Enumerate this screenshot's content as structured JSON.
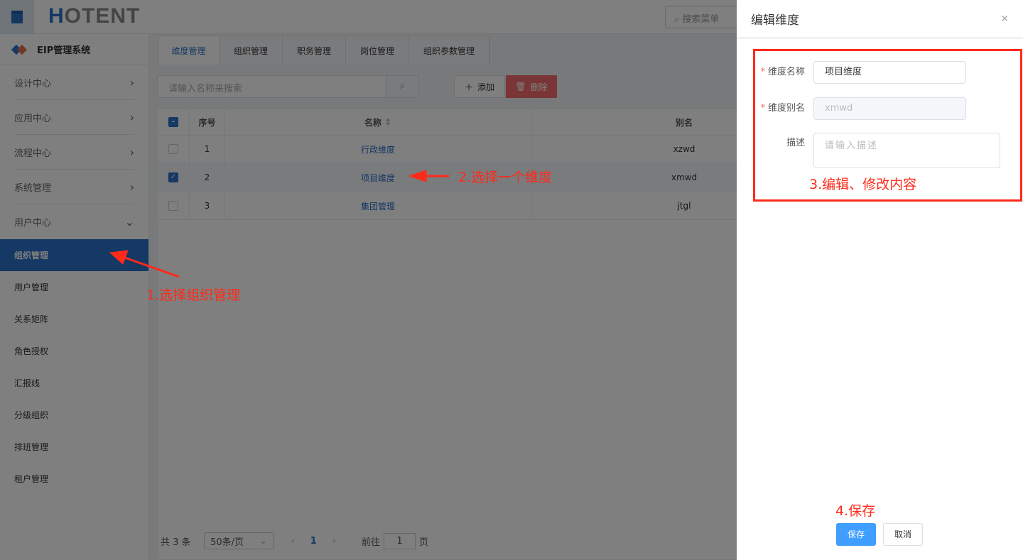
{
  "header": {
    "logo": "HOTENT",
    "menu_search_placeholder": "搜索菜单"
  },
  "sidebar": {
    "system_title": "EIP管理系统",
    "groups": [
      {
        "label": "设计中心"
      },
      {
        "label": "应用中心"
      },
      {
        "label": "流程中心"
      },
      {
        "label": "系统管理"
      },
      {
        "label": "用户中心"
      }
    ],
    "items": [
      {
        "label": "组织管理"
      },
      {
        "label": "用户管理"
      },
      {
        "label": "关系矩阵"
      },
      {
        "label": "角色授权"
      },
      {
        "label": "汇报线"
      },
      {
        "label": "分级组织"
      },
      {
        "label": "排班管理"
      },
      {
        "label": "租户管理"
      }
    ]
  },
  "tabs": [
    {
      "label": "维度管理"
    },
    {
      "label": "组织管理"
    },
    {
      "label": "职务管理"
    },
    {
      "label": "岗位管理"
    },
    {
      "label": "组织参数管理"
    }
  ],
  "toolbar": {
    "search_placeholder": "请输入名称来搜索",
    "add_label": "添加",
    "delete_label": "删除"
  },
  "table": {
    "headers": {
      "index": "序号",
      "name": "名称",
      "alias": "别名"
    },
    "rows": [
      {
        "index": "1",
        "name": "行政维度",
        "alias": "xzwd",
        "checked": false
      },
      {
        "index": "2",
        "name": "项目维度",
        "alias": "xmwd",
        "checked": true
      },
      {
        "index": "3",
        "name": "集团管理",
        "alias": "jtgl",
        "checked": false
      }
    ]
  },
  "pagination": {
    "total": "共 3 条",
    "page_size": "50条/页",
    "current": "1",
    "goto_label": "前往",
    "goto_value": "1",
    "page_suffix": "页"
  },
  "drawer": {
    "title": "编辑维度",
    "fields": {
      "name_label": "维度名称",
      "name_value": "项目维度",
      "alias_label": "维度别名",
      "alias_value": "xmwd",
      "desc_label": "描述",
      "desc_placeholder": "请输入描述"
    },
    "save_label": "保存",
    "cancel_label": "取消"
  },
  "annotations": {
    "step1": "1.选择组织管理",
    "step2": "2.选择一个维度",
    "step3": "3.编辑、修改内容",
    "step4": "4.保存"
  },
  "colors": {
    "primary": "#2a70c8",
    "danger": "#f56c6c",
    "annotation": "#ff2a1a",
    "save": "#409eff"
  }
}
